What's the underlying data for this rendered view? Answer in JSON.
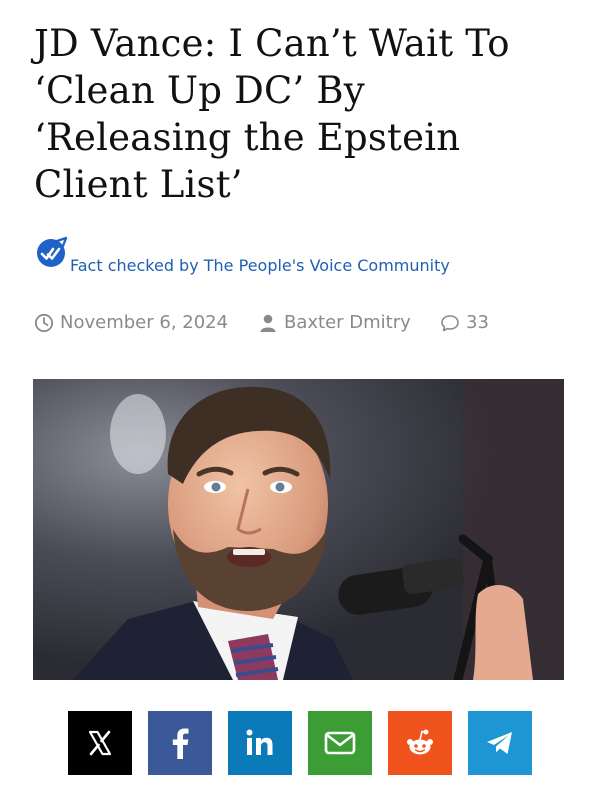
{
  "article": {
    "headline_lines": [
      "JD Vance: I Can’t Wait To",
      "‘Clean Up DC’ By",
      "‘Releasing the Epstein",
      "Client List’"
    ],
    "fact_check": "Fact checked by The People's Voice Community",
    "date": "November 6, 2024",
    "author": "Baxter Dmitry",
    "comments": "33"
  },
  "share": [
    {
      "name": "x-share-button",
      "icon": "x-icon",
      "color": "#000000"
    },
    {
      "name": "facebook-share-button",
      "icon": "facebook-icon",
      "color": "#3b5998"
    },
    {
      "name": "linkedin-share-button",
      "icon": "linkedin-icon",
      "color": "#0a7ab8"
    },
    {
      "name": "email-share-button",
      "icon": "email-icon",
      "color": "#3c9d35"
    },
    {
      "name": "reddit-share-button",
      "icon": "reddit-icon",
      "color": "#f0521b"
    },
    {
      "name": "telegram-share-button",
      "icon": "telegram-icon",
      "color": "#1e96d3"
    }
  ],
  "colors": {
    "fact_check_text": "#1f5fb3",
    "badge": "#1f63c6",
    "meta_text": "#8a8a8a"
  }
}
